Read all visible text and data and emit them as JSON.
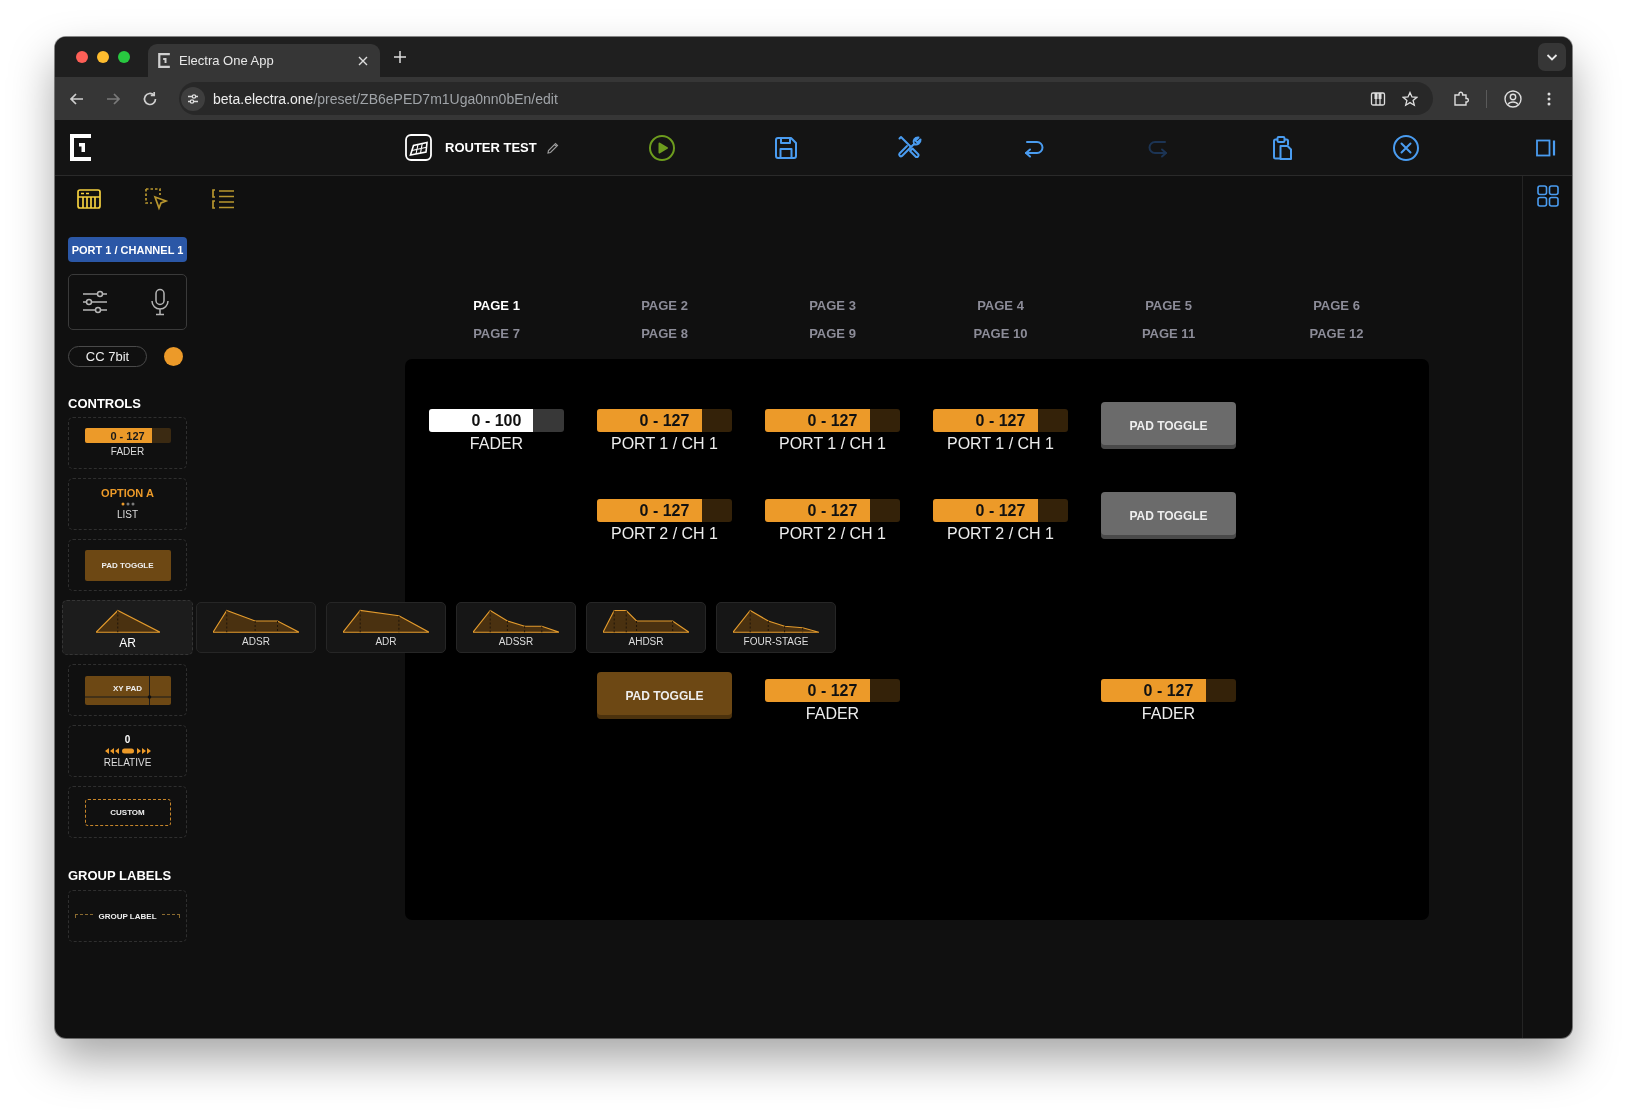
{
  "browser": {
    "tab_title": "Electra One App",
    "url_host": "beta.electra.one",
    "url_path": "/preset/ZB6ePED7m1Uga0nn0bEn/edit"
  },
  "header": {
    "preset_name": "ROUTER TEST",
    "tools": [
      {
        "kind": "play",
        "disabled": false
      },
      {
        "kind": "save",
        "disabled": false
      },
      {
        "kind": "tools",
        "disabled": false
      },
      {
        "kind": "undo",
        "disabled": false
      },
      {
        "kind": "redo",
        "disabled": true
      },
      {
        "kind": "paste",
        "disabled": false
      },
      {
        "kind": "close",
        "disabled": false
      }
    ]
  },
  "sidebar": {
    "tabs": [
      {
        "kind": "device",
        "selected": true
      },
      {
        "kind": "select",
        "selected": false
      },
      {
        "kind": "list",
        "selected": false
      }
    ],
    "port_button": "PORT 1 / CHANNEL 1",
    "message_type": "CC 7bit",
    "controls_title": "CONTROLS",
    "controls": [
      {
        "kind": "fader",
        "value": "0 - 127",
        "label": "FADER",
        "level": 0.78
      },
      {
        "kind": "list",
        "value": "OPTION A",
        "label": "LIST"
      },
      {
        "kind": "pad",
        "label": "PAD TOGGLE"
      },
      {
        "kind": "envelopes",
        "items": [
          {
            "kind": "ar",
            "label": "AR",
            "selected": true
          },
          {
            "kind": "adsr",
            "label": "ADSR",
            "selected": false
          },
          {
            "kind": "adr",
            "label": "ADR",
            "selected": false
          },
          {
            "kind": "adssr",
            "label": "ADSSR",
            "selected": false
          },
          {
            "kind": "ahdsr",
            "label": "AHDSR",
            "selected": false
          },
          {
            "kind": "four_stage",
            "label": "FOUR-STAGE",
            "selected": false
          }
        ]
      },
      {
        "kind": "xy",
        "label": "XY PAD"
      },
      {
        "kind": "relative",
        "value": "0",
        "label": "RELATIVE"
      },
      {
        "kind": "custom",
        "label": "CUSTOM"
      }
    ],
    "group_labels_title": "GROUP LABELS",
    "group_label": "GROUP LABEL"
  },
  "pages": [
    {
      "label": "PAGE 1",
      "selected": true
    },
    {
      "label": "PAGE 2",
      "selected": false
    },
    {
      "label": "PAGE 3",
      "selected": false
    },
    {
      "label": "PAGE 4",
      "selected": false
    },
    {
      "label": "PAGE 5",
      "selected": false
    },
    {
      "label": "PAGE 6",
      "selected": false
    },
    {
      "label": "PAGE 7",
      "selected": false
    },
    {
      "label": "PAGE 8",
      "selected": false
    },
    {
      "label": "PAGE 9",
      "selected": false
    },
    {
      "label": "PAGE 10",
      "selected": false
    },
    {
      "label": "PAGE 11",
      "selected": false
    },
    {
      "label": "PAGE 12",
      "selected": false
    }
  ],
  "canvas": {
    "rows": [
      {
        "cells": [
          {
            "kind": "fader",
            "value": "0 - 100",
            "label": "FADER",
            "level": 0.77,
            "color": "#ffffff"
          },
          {
            "kind": "fader",
            "value": "0 - 127",
            "label": "PORT 1 / CH 1",
            "level": 0.78,
            "color": "#ec9a29"
          },
          {
            "kind": "fader",
            "value": "0 - 127",
            "label": "PORT 1 / CH 1",
            "level": 0.78,
            "color": "#ec9a29"
          },
          {
            "kind": "fader",
            "value": "0 - 127",
            "label": "PORT 1 / CH 1",
            "level": 0.78,
            "color": "#ec9a29"
          },
          {
            "kind": "pad",
            "label": "PAD TOGGLE",
            "color": "#6b6b6b"
          }
        ]
      },
      {
        "cells": [
          {
            "kind": "empty"
          },
          {
            "kind": "fader",
            "value": "0 - 127",
            "label": "PORT 2 / CH 1",
            "level": 0.78,
            "color": "#ec9a29"
          },
          {
            "kind": "fader",
            "value": "0 - 127",
            "label": "PORT 2 / CH 1",
            "level": 0.78,
            "color": "#ec9a29"
          },
          {
            "kind": "fader",
            "value": "0 - 127",
            "label": "PORT 2 / CH 1",
            "level": 0.78,
            "color": "#ec9a29"
          },
          {
            "kind": "pad",
            "label": "PAD TOGGLE",
            "color": "#6b6b6b"
          }
        ]
      },
      {
        "cells": [
          {
            "kind": "empty"
          }
        ]
      },
      {
        "cells": [
          {
            "kind": "empty"
          },
          {
            "kind": "pad",
            "label": "PAD TOGGLE",
            "color": "#6d4814"
          },
          {
            "kind": "fader",
            "value": "0 - 127",
            "label": "FADER",
            "level": 0.78,
            "color": "#ec9a29"
          },
          {
            "kind": "empty"
          },
          {
            "kind": "fader",
            "value": "0 - 127",
            "label": "FADER",
            "level": 0.78,
            "color": "#ec9a29"
          }
        ]
      }
    ]
  }
}
